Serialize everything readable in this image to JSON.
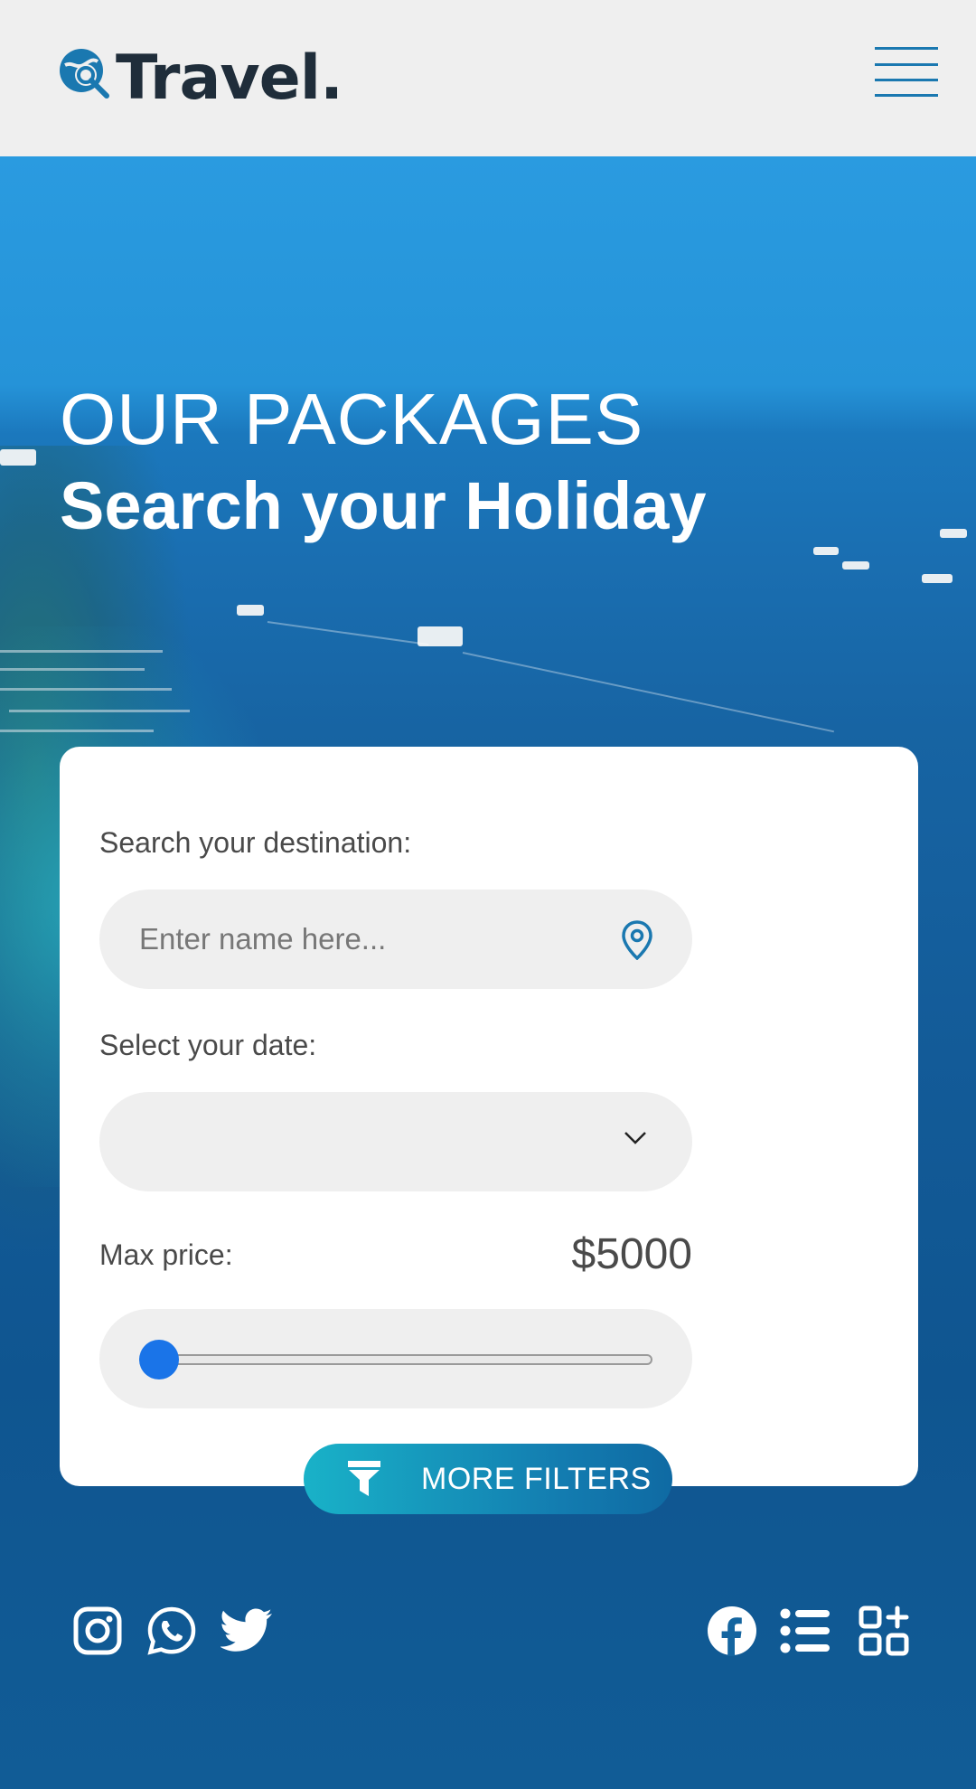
{
  "header": {
    "brand": "Travel.",
    "logo_icon": "globe-search-icon",
    "menu_icon": "hamburger-menu-icon"
  },
  "hero": {
    "title_light": "OUR PACKAGES",
    "title_bold": "Search your Holiday"
  },
  "search_form": {
    "destination_label": "Search your destination:",
    "destination_placeholder": "Enter name here...",
    "destination_value": "",
    "destination_icon": "location-pin-icon",
    "date_label": "Select your date:",
    "date_value": "",
    "date_icon": "chevron-down-icon",
    "price_label": "Max price:",
    "price_value": "$5000",
    "price_slider_fraction": 0
  },
  "filters_button": {
    "label": "MORE FILTERS",
    "icon": "funnel-icon"
  },
  "footer_icons": {
    "left": [
      "instagram-icon",
      "whatsapp-icon",
      "twitter-icon"
    ],
    "right": [
      "facebook-icon",
      "list-icon",
      "grid-add-icon"
    ]
  },
  "colors": {
    "accent": "#1a78b0",
    "slider_thumb": "#1a74e8",
    "button_start": "#19b2c8",
    "button_end": "#0f6aa3",
    "header_bg": "#efefef"
  }
}
